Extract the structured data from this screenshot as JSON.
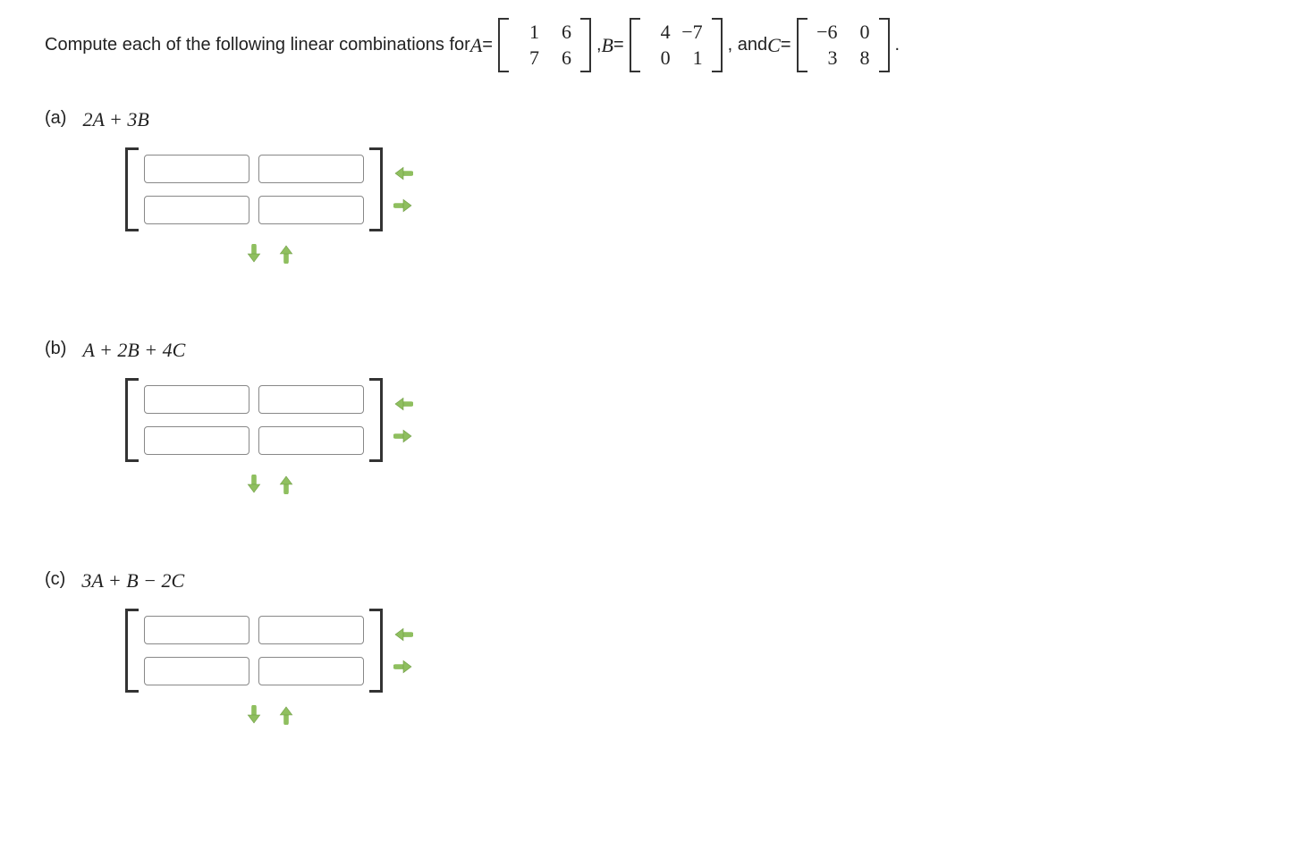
{
  "intro": {
    "prefix": "Compute each of the following linear combinations for ",
    "A_label": "A",
    "eq": " = ",
    "comma_B": ", ",
    "B_label": "B",
    "comma_and": ", and ",
    "C_label": "C",
    "period": "."
  },
  "matrices": {
    "A": [
      [
        "1",
        "6"
      ],
      [
        "7",
        "6"
      ]
    ],
    "B": [
      [
        "4",
        "−7"
      ],
      [
        "0",
        "1"
      ]
    ],
    "C": [
      [
        "−6",
        "0"
      ],
      [
        "3",
        "8"
      ]
    ]
  },
  "parts": [
    {
      "label": "(a)",
      "expr_html": "2A + 3B"
    },
    {
      "label": "(b)",
      "expr_html": "A + 2B + 4C"
    },
    {
      "label": "(c)",
      "expr_html": "3A + B − 2C"
    }
  ],
  "answer_grid": {
    "rows": 2,
    "cols": 2
  }
}
